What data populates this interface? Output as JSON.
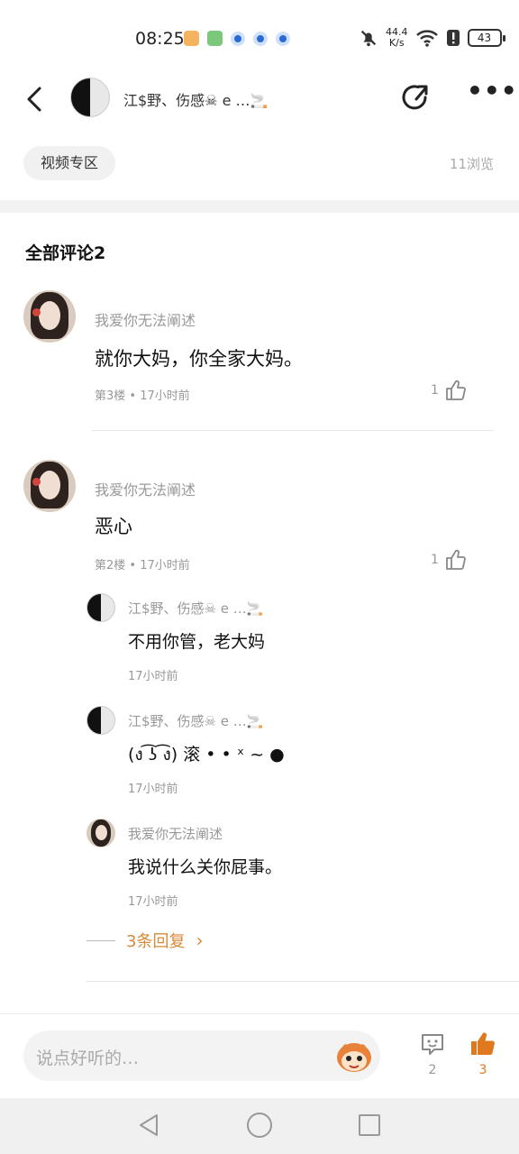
{
  "status_bar": {
    "time": "08:25",
    "net_speed_value": "44.4",
    "net_speed_unit": "K/s",
    "battery": "43"
  },
  "header": {
    "title": "江$野、伤感☠ e …🚬"
  },
  "post": {
    "tag": "视频专区",
    "views": "11浏览"
  },
  "comments_section": {
    "title": "全部评论2"
  },
  "comments": [
    {
      "user": "我爱你无法阐述",
      "text": "就你大妈，你全家大妈。",
      "floor_time": "第3楼 • 17小时前",
      "likes": "1"
    },
    {
      "user": "我爱你无法阐述",
      "text": "恶心",
      "floor_time": "第2楼 • 17小时前",
      "likes": "1"
    }
  ],
  "replies": [
    {
      "user": "江$野、伤感☠ e …🚬",
      "text": "不用你管，老大妈",
      "time": "17小时前"
    },
    {
      "user": "江$野、伤感☠ e …🚬",
      "text": "(ง ͡ʖ ͡ง)  滚 • • ˣ ~ ●",
      "time": "17小时前"
    },
    {
      "user": "我爱你无法阐述",
      "text": "我说什么关你屁事。",
      "time": "17小时前"
    }
  ],
  "more_replies": {
    "label": "3条回复"
  },
  "bottom_bar": {
    "placeholder": "说点好听的…",
    "comment_count": "2",
    "like_count": "3"
  },
  "colors": {
    "accent": "#e0781d",
    "more_replies": "#d88a38",
    "muted_text": "#999999"
  }
}
